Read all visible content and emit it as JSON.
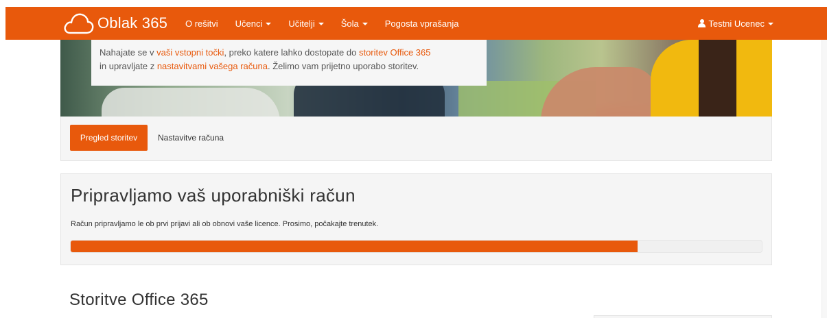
{
  "brand": {
    "name": "Oblak 365",
    "icon": "cloud-icon"
  },
  "nav": {
    "items": [
      {
        "label": "O rešitvi",
        "dropdown": false
      },
      {
        "label": "Učenci",
        "dropdown": true
      },
      {
        "label": "Učitelji",
        "dropdown": true
      },
      {
        "label": "Šola",
        "dropdown": true
      },
      {
        "label": "Pogosta vprašanja",
        "dropdown": false
      }
    ],
    "user": {
      "label": "Testni Ucenec",
      "icon": "user-icon"
    }
  },
  "banner": {
    "line1_pre": "Nahajate se v ",
    "line1_link1": "vaši vstopni točki",
    "line1_mid": ", preko katere lahko dostopate do ",
    "line1_link2": "storitev Office 365",
    "line2_pre": "in upravljate z ",
    "line2_link": "nastavitvami vašega računa",
    "line2_post": ". Želimo vam prijetno uporabo storitev."
  },
  "tabs": {
    "active": "Pregled storitev",
    "other": "Nastavitve računa"
  },
  "progress": {
    "title": "Pripravljamo vaš uporabniški račun",
    "description": "Račun pripravljamo le ob prvi prijavi ali ob obnovi vaše licence. Prosimo, počakajte trenutek.",
    "percent": 82
  },
  "services": {
    "title": "Storitve Office 365"
  },
  "colors": {
    "accent": "#e8590c",
    "panel": "#f5f5f5"
  }
}
